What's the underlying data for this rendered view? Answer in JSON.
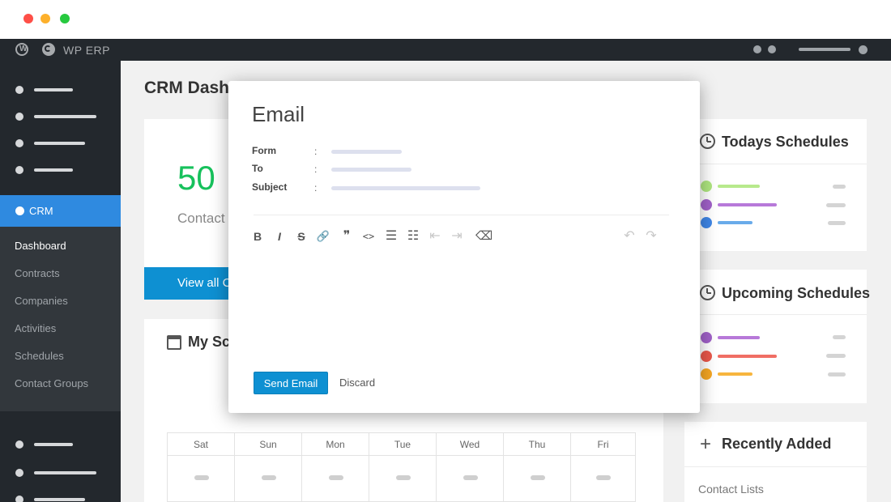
{
  "window": {
    "traffic_lights": [
      "#fe4f47",
      "#fdb02b",
      "#27c93f"
    ]
  },
  "adminbar": {
    "title": "WP ERP",
    "wp_icon": "wordpress-icon",
    "erp_icon": "erp-logo-icon"
  },
  "sidebar": {
    "crm_label": "CRM",
    "submenu": [
      "Dashboard",
      "Contracts",
      "Companies",
      "Activities",
      "Schedules",
      "Contact Groups"
    ],
    "active_item": "Dashboard",
    "accent": "#2f8ae0"
  },
  "main": {
    "title": "CRM Dash",
    "stat_value": "50",
    "stat_label": "Contact",
    "view_all_label": "View all C",
    "calendar_title": "My Sc",
    "calendar_icon": "calendar-icon",
    "days": [
      "Sat",
      "Sun",
      "Mon",
      "Tue",
      "Wed",
      "Thu",
      "Fri"
    ]
  },
  "right": {
    "todays_title": "Todays Schedules",
    "upcoming_title": "Upcoming Schedules",
    "recent_title": "Recently Added",
    "contact_lists": "Contact Lists",
    "todays_colors": [
      "#aee57f",
      "#a061c8",
      "#3f86e6"
    ],
    "todays_bar_colors": [
      "#b7e98c",
      "#b779d9",
      "#69abea"
    ],
    "upcoming_colors": [
      "#a061c8",
      "#e9574a",
      "#f5a623"
    ],
    "upcoming_bar_colors": [
      "#b779d9",
      "#f06e64",
      "#f7b53e"
    ]
  },
  "modal": {
    "title": "Email",
    "fields": [
      {
        "label": "Form",
        "colon": ":"
      },
      {
        "label": "To",
        "colon": ":"
      },
      {
        "label": "Subject",
        "colon": ":"
      }
    ],
    "toolbar": {
      "bold": "B",
      "italic": "I",
      "strikethrough": "S",
      "link": "🔗",
      "quote": "❞",
      "code": "<>",
      "bullet_list": "☰",
      "ordered_list": "☷",
      "outdent": "⇤",
      "indent": "⇥",
      "clear": "⌫",
      "undo": "↶",
      "redo": "↷"
    },
    "send_label": "Send Email",
    "discard_label": "Discard",
    "accent": "#0e90d2"
  }
}
